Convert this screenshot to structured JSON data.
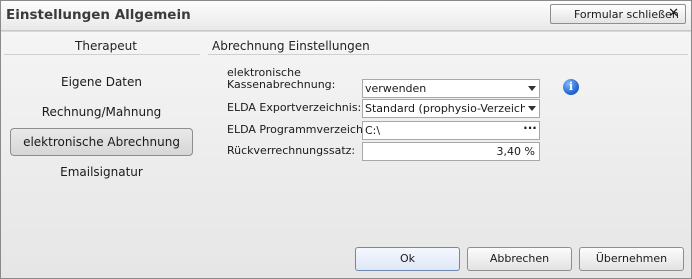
{
  "window": {
    "title": "Einstellungen Allgemein"
  },
  "toolbar": {
    "close_form_label": "Formular schließen",
    "close_glyph": "✕"
  },
  "sections": {
    "left_header": "Therapeut",
    "right_header": "Abrechnung Einstellungen"
  },
  "nav": {
    "items": [
      {
        "label": "Eigene Daten"
      },
      {
        "label": "Rechnung/Mahnung"
      },
      {
        "label": "elektronische Abrechnung",
        "active": true
      },
      {
        "label": "Emailsignatur"
      }
    ]
  },
  "form": {
    "kassen_label_1": "elektronische",
    "kassen_label_2": "Kassenabrechnung:",
    "kassen_value": "verwenden",
    "export_label": "ELDA Exportverzeichnis:",
    "export_value": "Standard (prophysio-Verzeichnis",
    "programm_label": "ELDA Programmverzeichnis:",
    "programm_value": "C:\\",
    "rueck_label": "Rückverrechnungssatz:",
    "rueck_value": "3,40 %"
  },
  "icons": {
    "info": "info-icon",
    "info_glyph": "i",
    "dots_glyph": "···"
  },
  "buttons": {
    "ok": "Ok",
    "cancel": "Abbrechen",
    "apply": "Übernehmen"
  }
}
